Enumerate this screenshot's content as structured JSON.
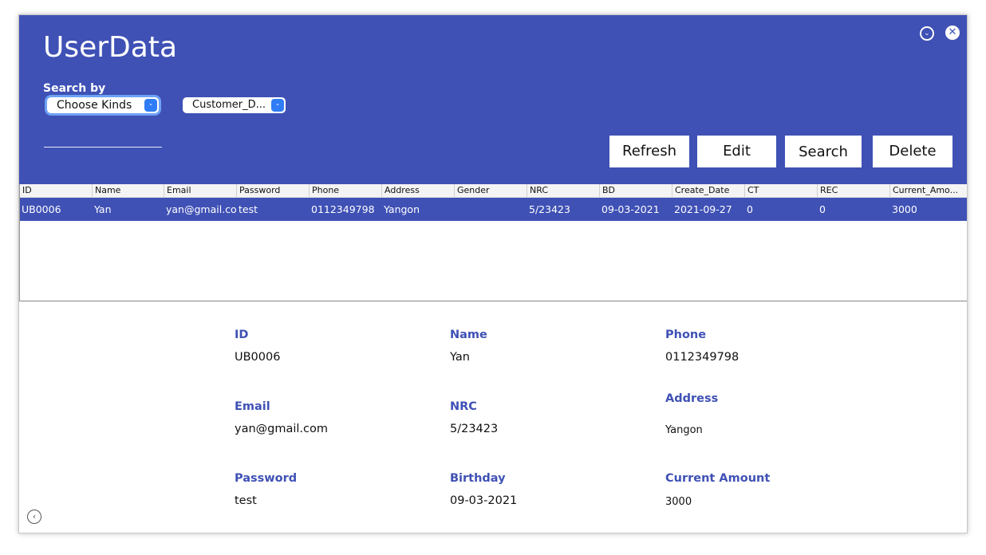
{
  "header": {
    "title": "UserData",
    "search_by_label": "Search by",
    "kind_select": "Choose Kinds",
    "table_select": "Customer_D...",
    "buttons": {
      "refresh": "Refresh",
      "edit": "Edit",
      "search": "Search",
      "delete": "Delete"
    }
  },
  "table": {
    "columns": [
      "ID",
      "Name",
      "Email",
      "Password",
      "Phone",
      "Address",
      "Gender",
      "NRC",
      "BD",
      "Create_Date",
      "CT",
      "REC",
      "Current_Amo..."
    ],
    "rows": [
      [
        "UB0006",
        "Yan",
        "yan@gmail.com",
        "test",
        "0112349798",
        "Yangon",
        "",
        "5/23423",
        "09-03-2021",
        "2021-09-27",
        "0",
        "0",
        "3000"
      ]
    ]
  },
  "detail": {
    "id_label": "ID",
    "id_value": "UB0006",
    "name_label": "Name",
    "name_value": "Yan",
    "phone_label": "Phone",
    "phone_value": "0112349798",
    "email_label": "Email",
    "email_value": "yan@gmail.com",
    "nrc_label": "NRC",
    "nrc_value": "5/23423",
    "address_label": "Address",
    "address_value": "Yangon",
    "password_label": "Password",
    "password_value": "test",
    "birthday_label": "Birthday",
    "birthday_value": "09-03-2021",
    "amount_label": "Current Amount",
    "amount_value": "3000"
  },
  "colors": {
    "accent": "#3f51b5",
    "select_arrow": "#2f7df6"
  },
  "icons": {
    "minimize": "chevron-down-circle-icon",
    "close": "close-circle-icon",
    "back": "chevron-left-circle-icon"
  }
}
